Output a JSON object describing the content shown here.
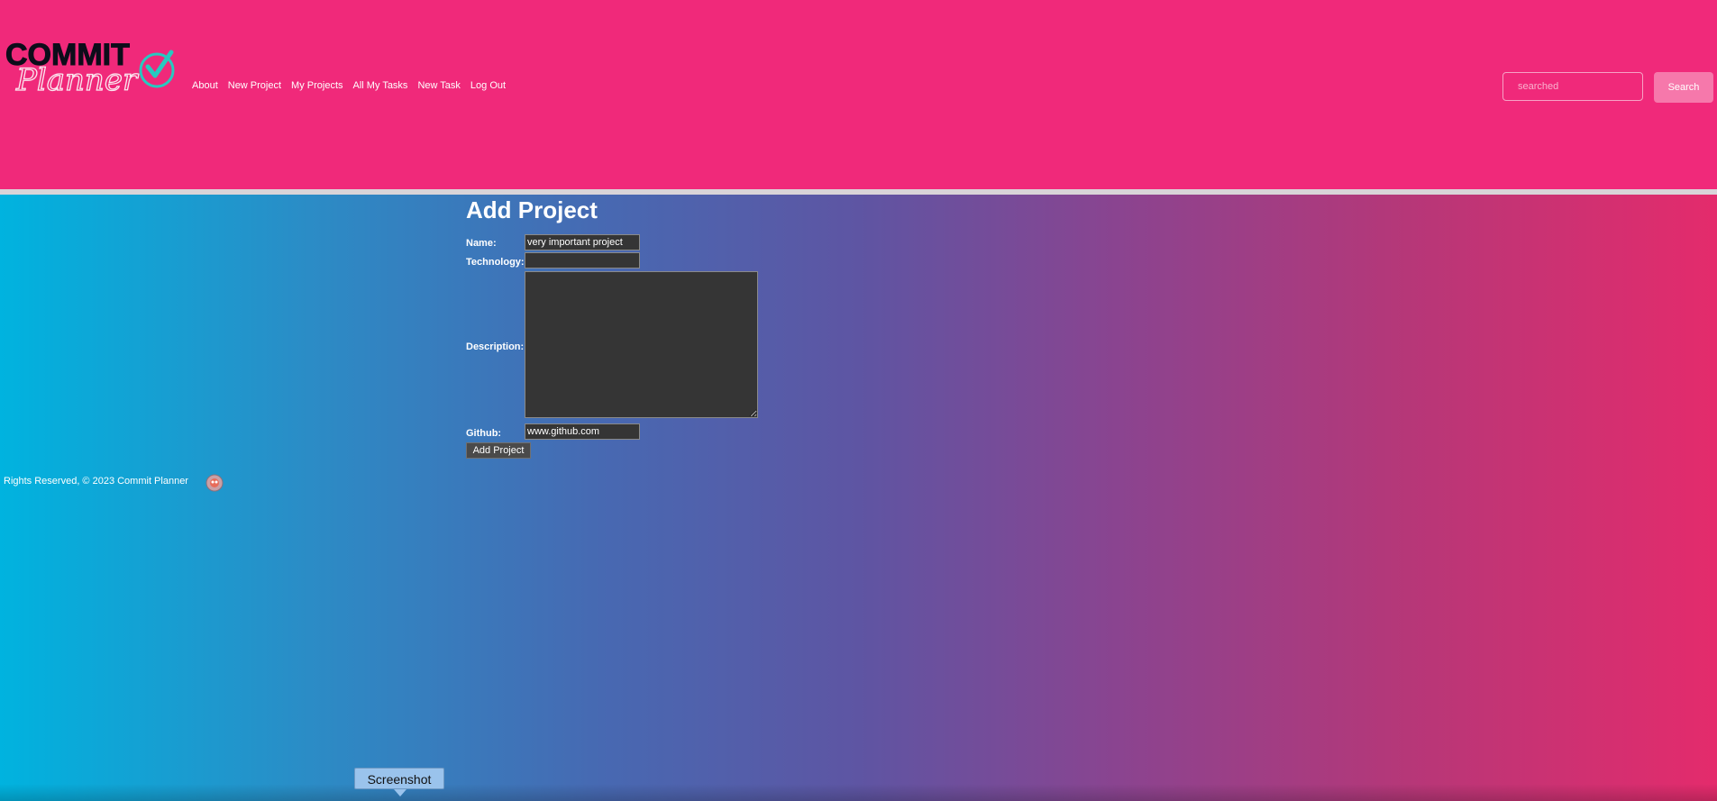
{
  "brand": {
    "logo_word1": "COMMIT",
    "logo_word2": "Planner",
    "accent": "#f0297a"
  },
  "nav": {
    "items": [
      "About",
      "New Project",
      "My Projects",
      "All My Tasks",
      "New Task",
      "Log Out"
    ]
  },
  "search": {
    "placeholder": "searched",
    "button_label": "Search"
  },
  "form": {
    "title": "Add Project",
    "name_label": "Name:",
    "name_value": "very important project",
    "technology_label": "Technology:",
    "technology_value": "",
    "description_label": "Description:",
    "description_value": "",
    "github_label": "Github:",
    "github_value": "www.github.com",
    "submit_label": "Add Project"
  },
  "footer": {
    "text": "Rights Reserved, © 2023 Commit Planner",
    "icon": "robot-avatar-icon"
  },
  "tooltip": {
    "label": "Screenshot"
  },
  "colors": {
    "header_bg": "#f0297a",
    "gradient_left": "#00b3df",
    "gradient_right": "#e42b6c",
    "field_bg": "#353535"
  }
}
